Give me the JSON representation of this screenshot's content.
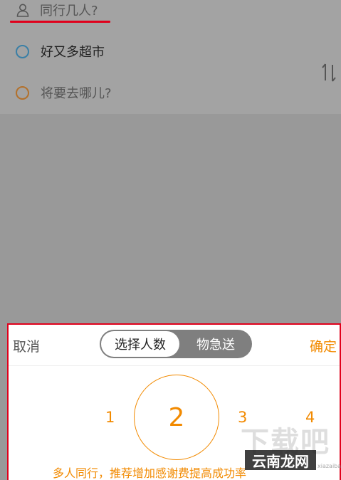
{
  "form": {
    "passengers_placeholder": "同行几人?",
    "origin": "好又多超市",
    "destination_placeholder": "将要去哪儿?"
  },
  "sheet": {
    "cancel_label": "取消",
    "confirm_label": "确定",
    "segments": {
      "active": "选择人数",
      "inactive": "物急送"
    },
    "numbers": {
      "n1": "1",
      "selected": "2",
      "n3": "3",
      "n4": "4"
    },
    "hint": "多人同行，推荐增加感谢费提高成功率"
  },
  "watermark": {
    "big": "下载吧",
    "box": "云南龙网",
    "small": "xiazaiba"
  },
  "colors": {
    "accent": "#f28a00",
    "highlight": "#e0001b",
    "overlay": "#999999"
  }
}
